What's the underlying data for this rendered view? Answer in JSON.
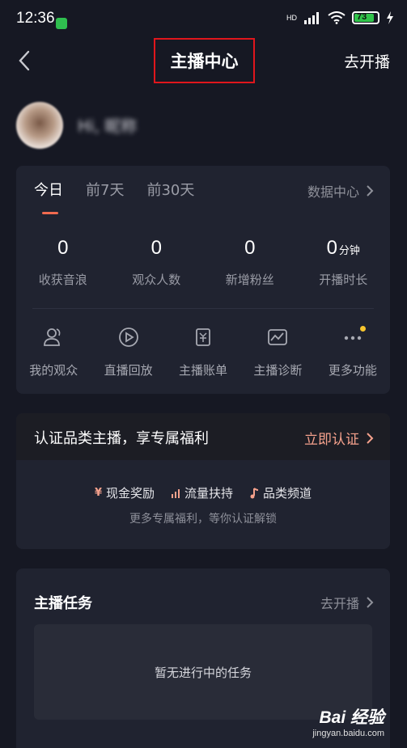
{
  "status_bar": {
    "time": "12:36",
    "battery": "73",
    "network": "HD"
  },
  "nav": {
    "title": "主播中心",
    "action": "去开播"
  },
  "profile": {
    "username": "Hi, 昵称"
  },
  "stats_card": {
    "tabs": [
      "今日",
      "前7天",
      "前30天"
    ],
    "active_tab": 0,
    "data_center": "数据中心",
    "stats": [
      {
        "value": "0",
        "unit": "",
        "label": "收获音浪"
      },
      {
        "value": "0",
        "unit": "",
        "label": "观众人数"
      },
      {
        "value": "0",
        "unit": "",
        "label": "新增粉丝"
      },
      {
        "value": "0",
        "unit": "分钟",
        "label": "开播时长"
      }
    ],
    "functions": [
      {
        "label": "我的观众",
        "icon": "audience-icon"
      },
      {
        "label": "直播回放",
        "icon": "replay-icon"
      },
      {
        "label": "主播账单",
        "icon": "bill-icon"
      },
      {
        "label": "主播诊断",
        "icon": "diagnosis-icon"
      },
      {
        "label": "更多功能",
        "icon": "more-icon"
      }
    ]
  },
  "cert_card": {
    "title": "认证品类主播，享专属福利",
    "action": "立即认证",
    "perks": [
      {
        "icon": "¥",
        "label": "现金奖励"
      },
      {
        "icon": "bars",
        "label": "流量扶持"
      },
      {
        "icon": "note",
        "label": "品类频道"
      }
    ],
    "subtitle": "更多专属福利，等你认证解锁"
  },
  "task_card": {
    "title": "主播任务",
    "action": "去开播",
    "empty_text": "暂无进行中的任务"
  },
  "watermark": {
    "main": "Bai 经验",
    "sub": "jingyan.baidu.com"
  },
  "colors": {
    "accent": "#f06a4f",
    "highlight_box": "#e0161c",
    "background": "#161823"
  }
}
